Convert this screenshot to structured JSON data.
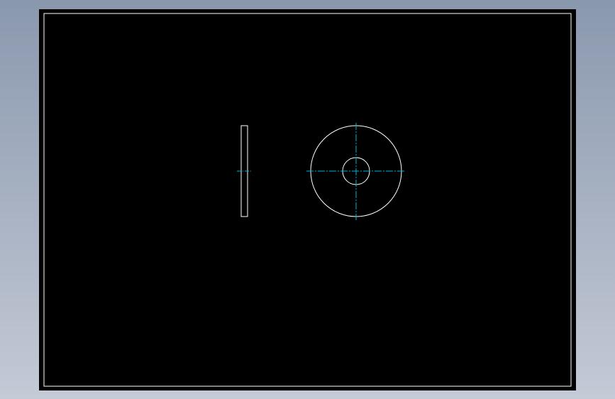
{
  "viewport": {
    "background_top": "#8a98ae",
    "background_bottom": "#c4cad6"
  },
  "sheet": {
    "background": "#000000",
    "border_color": "#ffffff"
  },
  "drawing": {
    "geometry_color": "#ffffff",
    "centerline_color": "#00b4d8",
    "views": [
      {
        "name": "side-view",
        "shape": "rectangle"
      },
      {
        "name": "front-view",
        "shape": "washer",
        "outer_to_inner_ratio": 3.3
      }
    ]
  }
}
